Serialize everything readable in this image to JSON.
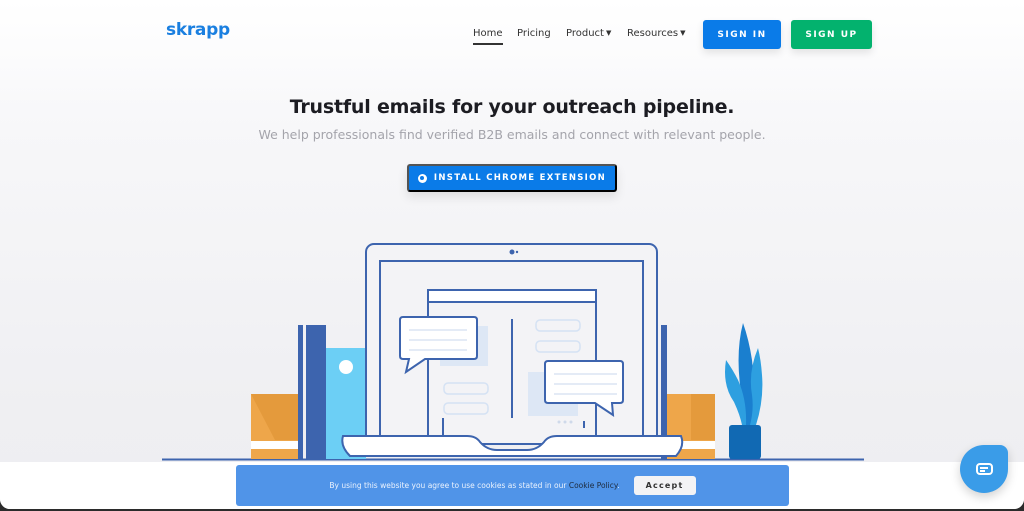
{
  "header": {
    "logo": "skrapp",
    "nav": [
      {
        "label": "Home",
        "active": true
      },
      {
        "label": "Pricing"
      },
      {
        "label": "Product",
        "has_dropdown": true
      },
      {
        "label": "Resources",
        "has_dropdown": true
      }
    ],
    "signin_label": "SIGN IN",
    "signup_label": "SIGN UP",
    "caret": "▼"
  },
  "hero": {
    "title": "Trustful emails for your outreach pipeline.",
    "subtitle": "We help professionals find verified B2B emails and connect with relevant people.",
    "cta_label": "INSTALL CHROME EXTENSION",
    "cta_icon": "chrome-icon"
  },
  "cookie": {
    "text": "By using this website you agree to use cookies as stated in our ",
    "link_label": "Cookie Policy",
    "suffix": ".",
    "accept_label": "Accept"
  },
  "chat_widget": {
    "icon": "chat-icon"
  },
  "colors": {
    "brand_blue": "#0a7be8",
    "signup_green": "#03b26e",
    "cookie_bar": "#5094e8",
    "illustration_navy": "#3d64ae",
    "illustration_orange": "#eea64a",
    "illustration_lightblue": "#6ccff5"
  }
}
